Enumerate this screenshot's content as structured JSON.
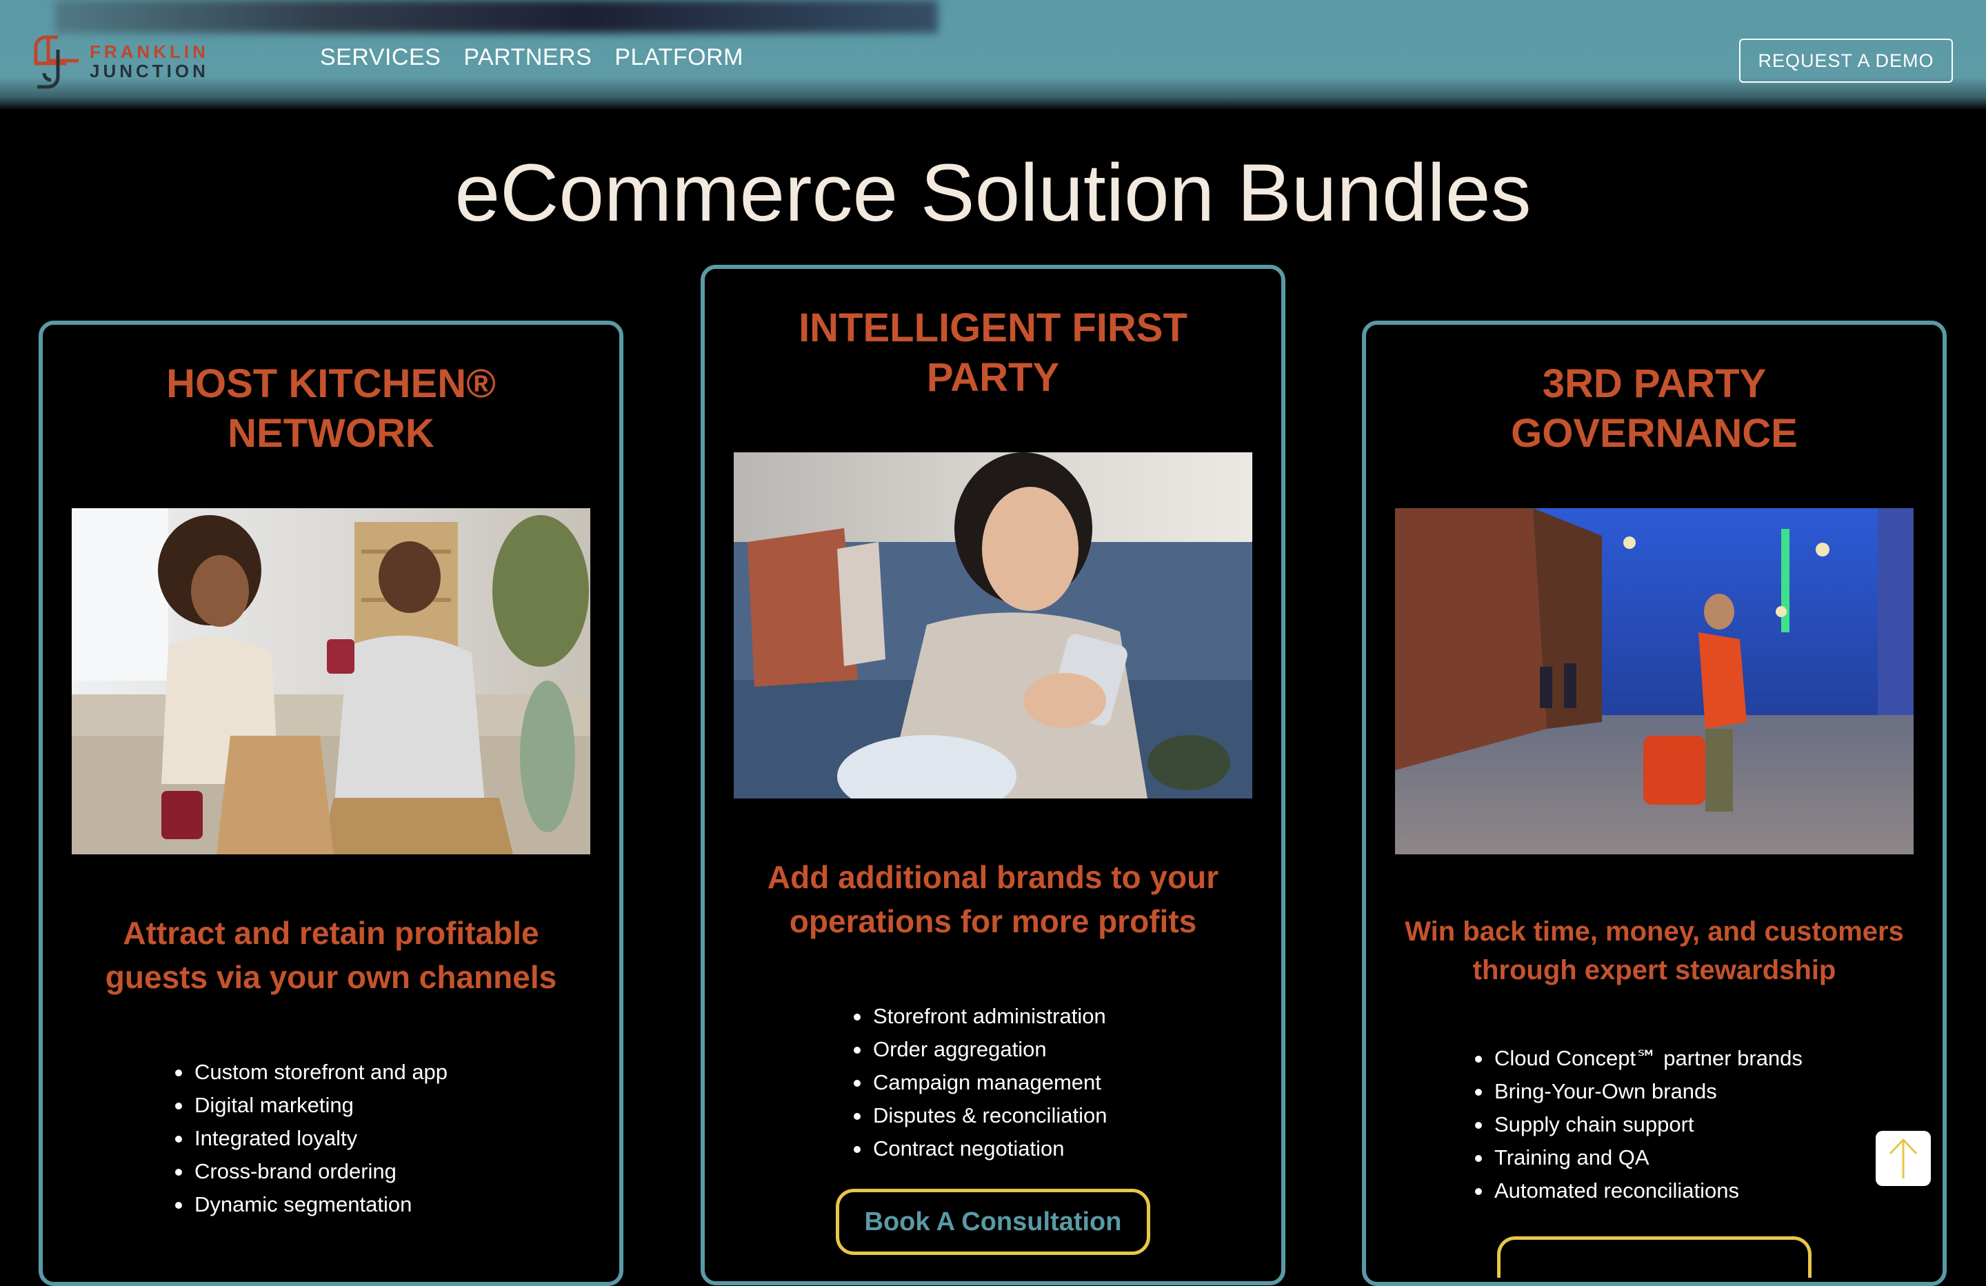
{
  "brand": {
    "line1": "FRANKLIN",
    "line2": "JUNCTION",
    "accent": "#c0462c",
    "teal": "#5a9aa6"
  },
  "nav": {
    "items": [
      "SERVICES",
      "PARTNERS",
      "PLATFORM"
    ],
    "cta": "REQUEST A DEMO"
  },
  "page": {
    "title": "eCommerce Solution Bundles"
  },
  "cards": [
    {
      "heading_line1": "HOST KITCHEN®",
      "heading_line2": "NETWORK",
      "image": "couple-sharing-takeout-photo",
      "subtitle_line1": "Attract and retain profitable",
      "subtitle_line2": "guests via your own channels",
      "features": [
        "Custom storefront and app",
        "Digital marketing",
        "Integrated loyalty",
        "Cross-brand ordering",
        "Dynamic segmentation"
      ]
    },
    {
      "heading_line1": "INTELLIGENT FIRST",
      "heading_line2": "PARTY",
      "image": "woman-using-phone-photo",
      "subtitle_line1": "Add additional brands to your",
      "subtitle_line2": "operations for more profits",
      "features": [
        "Storefront administration",
        "Order aggregation",
        "Campaign management",
        "Disputes & reconciliation",
        "Contract negotiation"
      ],
      "cta": "Book A Consultation"
    },
    {
      "heading_line1": "3RD PARTY",
      "heading_line2": "GOVERNANCE",
      "image": "delivery-courier-street-photo",
      "subtitle_line1": "Win back time, money, and customers",
      "subtitle_line2": "through expert stewardship",
      "features": [
        "Cloud Concept℠ partner brands",
        "Bring-Your-Own brands",
        "Supply chain support",
        "Training and QA",
        "Automated reconciliations"
      ]
    }
  ],
  "scroll_top": {
    "icon": "arrow-up-icon",
    "color": "#e8c64a"
  }
}
